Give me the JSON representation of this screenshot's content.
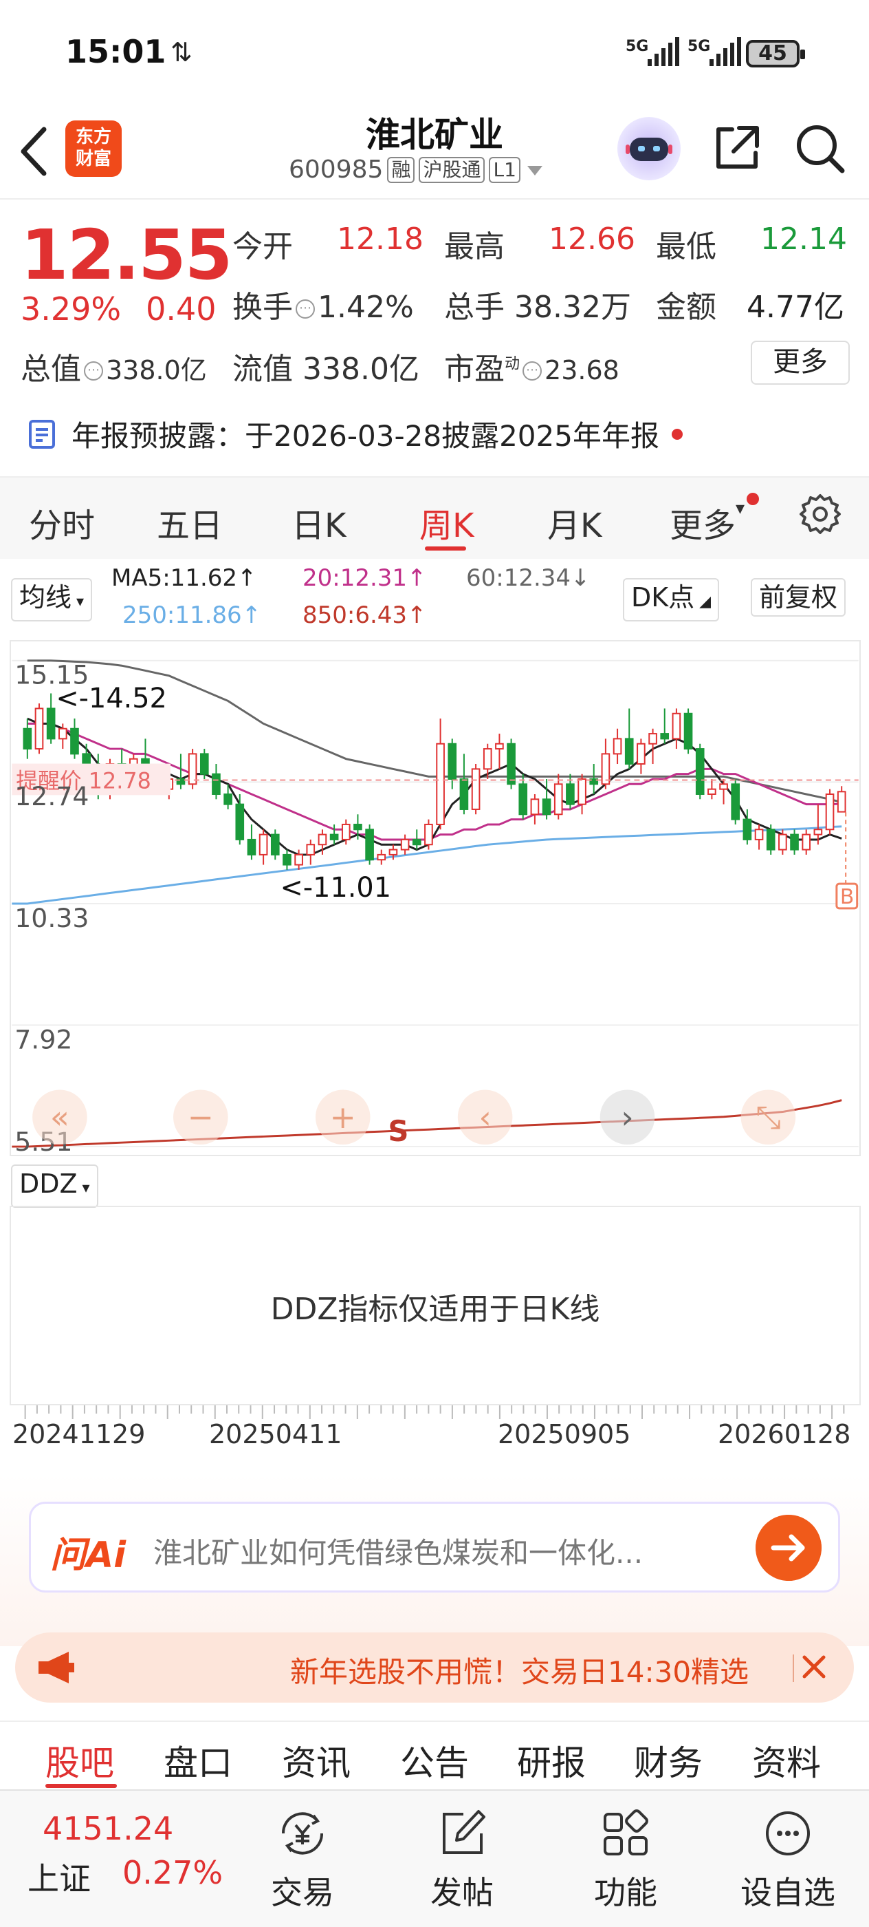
{
  "status": {
    "time": "15:01",
    "net_arrows": "⇅",
    "signal1": "5G",
    "signal2": "5G",
    "battery": "45"
  },
  "header": {
    "stock_name": "淮北矿业",
    "stock_code": "600985",
    "tag_rong": "融",
    "tag_hgt": "沪股通",
    "tag_l1": "L1",
    "logo_line1": "东方",
    "logo_line2": "财富"
  },
  "quote": {
    "price": "12.55",
    "change_pct": "3.29%",
    "change": "0.40",
    "open_label": "今开",
    "open": "12.18",
    "high_label": "最高",
    "high": "12.66",
    "low_label": "最低",
    "low": "12.14",
    "turnover_label": "换手",
    "turnover": "1.42%",
    "volume_label": "总手",
    "volume": "38.32万",
    "amount_label": "金额",
    "amount": "4.77亿",
    "mktcap_label": "总值",
    "mktcap": "338.0亿",
    "float_label": "流值",
    "float_cap": "338.0亿",
    "pe_label": "市盈",
    "pe_sup": "动",
    "pe": "23.68",
    "more": "更多"
  },
  "notice": "年报预披露：于2026-03-28披露2025年年报",
  "period_tabs": [
    "分时",
    "五日",
    "日K",
    "周K",
    "月K",
    "更多"
  ],
  "active_period": "周K",
  "ma_legend": {
    "selector": "均线",
    "ma5": "MA5:11.62↑",
    "ma20": "20:12.31↑",
    "ma60": "60:12.34↓",
    "ma250": "250:11.86↑",
    "ma850": "850:6.43↑",
    "dk_select": "DK点",
    "fq_select": "前复权",
    "color_ma5": "#222222",
    "color_ma20": "#c0308a",
    "color_ma60": "#666666",
    "color_ma250": "#6aaee6",
    "color_ma850": "#c0392b"
  },
  "chart_data": {
    "type": "candlestick",
    "y_ticks": [
      "15.15",
      "12.74",
      "10.33",
      "7.92",
      "5.51"
    ],
    "ylim": [
      5.51,
      15.15
    ],
    "annotation_high": "<-14.52",
    "annotation_low": "<-11.01",
    "alert_label": "提醒价 12.78",
    "alert_price": 12.78,
    "marker_b": "B",
    "marker_s": "S",
    "x_labels": [
      "20241129",
      "20250411",
      "20250905",
      "20260128"
    ],
    "candles": [
      [
        13.8,
        14.0,
        13.2,
        13.4
      ],
      [
        13.4,
        14.3,
        13.3,
        14.2
      ],
      [
        14.2,
        14.5,
        13.5,
        13.6
      ],
      [
        13.6,
        13.9,
        13.4,
        13.8
      ],
      [
        13.8,
        14.0,
        13.2,
        13.3
      ],
      [
        13.3,
        13.5,
        12.6,
        12.7
      ],
      [
        12.7,
        13.3,
        12.4,
        12.5
      ],
      [
        12.5,
        13.2,
        12.4,
        13.1
      ],
      [
        13.1,
        13.4,
        12.7,
        12.8
      ],
      [
        12.8,
        13.3,
        12.5,
        13.2
      ],
      [
        13.2,
        13.6,
        12.8,
        12.9
      ],
      [
        12.9,
        13.1,
        12.5,
        12.6
      ],
      [
        12.6,
        12.9,
        12.4,
        12.8
      ],
      [
        12.8,
        13.3,
        12.6,
        12.7
      ],
      [
        12.7,
        13.4,
        12.6,
        13.3
      ],
      [
        13.3,
        13.4,
        12.8,
        12.9
      ],
      [
        12.9,
        13.1,
        12.4,
        12.5
      ],
      [
        12.5,
        12.7,
        12.2,
        12.3
      ],
      [
        12.3,
        12.5,
        11.5,
        11.6
      ],
      [
        11.6,
        11.9,
        11.2,
        11.3
      ],
      [
        11.3,
        11.8,
        11.1,
        11.7
      ],
      [
        11.7,
        11.8,
        11.2,
        11.3
      ],
      [
        11.3,
        11.4,
        11.0,
        11.1
      ],
      [
        11.1,
        11.4,
        11.0,
        11.3
      ],
      [
        11.3,
        11.6,
        11.1,
        11.5
      ],
      [
        11.5,
        11.8,
        11.3,
        11.7
      ],
      [
        11.7,
        11.9,
        11.5,
        11.6
      ],
      [
        11.6,
        12.0,
        11.5,
        11.9
      ],
      [
        11.9,
        12.1,
        11.6,
        11.8
      ],
      [
        11.8,
        11.9,
        11.1,
        11.2
      ],
      [
        11.2,
        11.4,
        11.1,
        11.3
      ],
      [
        11.3,
        11.5,
        11.2,
        11.4
      ],
      [
        11.4,
        11.7,
        11.3,
        11.6
      ],
      [
        11.6,
        11.8,
        11.4,
        11.5
      ],
      [
        11.5,
        12.0,
        11.4,
        11.9
      ],
      [
        11.9,
        14.0,
        11.8,
        13.5
      ],
      [
        13.5,
        13.6,
        12.6,
        12.8
      ],
      [
        12.8,
        13.3,
        12.1,
        12.2
      ],
      [
        12.2,
        13.1,
        12.1,
        13.0
      ],
      [
        13.0,
        13.5,
        12.8,
        13.4
      ],
      [
        13.4,
        13.7,
        13.0,
        13.5
      ],
      [
        13.5,
        13.6,
        12.6,
        12.7
      ],
      [
        12.7,
        12.9,
        12.0,
        12.1
      ],
      [
        12.1,
        12.5,
        11.9,
        12.4
      ],
      [
        12.4,
        12.8,
        12.0,
        12.1
      ],
      [
        12.1,
        12.9,
        12.0,
        12.7
      ],
      [
        12.7,
        12.9,
        12.2,
        12.3
      ],
      [
        12.3,
        12.9,
        12.1,
        12.8
      ],
      [
        12.8,
        13.1,
        12.5,
        12.7
      ],
      [
        12.7,
        13.6,
        12.6,
        13.3
      ],
      [
        13.3,
        13.8,
        13.1,
        13.6
      ],
      [
        13.6,
        14.2,
        13.0,
        13.1
      ],
      [
        13.1,
        13.6,
        12.9,
        13.5
      ],
      [
        13.5,
        13.8,
        13.1,
        13.7
      ],
      [
        13.7,
        14.2,
        13.5,
        13.6
      ],
      [
        13.6,
        14.2,
        13.4,
        14.1
      ],
      [
        14.1,
        14.2,
        13.3,
        13.4
      ],
      [
        13.4,
        13.5,
        12.4,
        12.5
      ],
      [
        12.5,
        12.8,
        12.4,
        12.6
      ],
      [
        12.6,
        12.8,
        12.3,
        12.7
      ],
      [
        12.7,
        12.8,
        11.9,
        12.0
      ],
      [
        12.0,
        12.2,
        11.5,
        11.6
      ],
      [
        11.6,
        11.9,
        11.4,
        11.8
      ],
      [
        11.8,
        11.9,
        11.3,
        11.4
      ],
      [
        11.4,
        11.8,
        11.3,
        11.7
      ],
      [
        11.7,
        11.8,
        11.3,
        11.4
      ],
      [
        11.4,
        11.8,
        11.3,
        11.7
      ],
      [
        11.7,
        12.3,
        11.5,
        11.8
      ],
      [
        11.8,
        12.6,
        11.7,
        12.5
      ],
      [
        12.15,
        12.66,
        12.14,
        12.55
      ]
    ],
    "ma5": [
      14.0,
      13.9,
      13.9,
      13.8,
      13.6,
      13.4,
      13.1,
      13.0,
      12.9,
      12.8,
      12.9,
      12.9,
      12.9,
      12.8,
      12.9,
      12.9,
      12.8,
      12.7,
      12.3,
      12.0,
      11.8,
      11.6,
      11.4,
      11.3,
      11.3,
      11.4,
      11.5,
      11.6,
      11.7,
      11.6,
      11.5,
      11.5,
      11.5,
      11.4,
      11.5,
      11.9,
      12.3,
      12.5,
      12.8,
      12.9,
      13.0,
      13.1,
      12.9,
      12.8,
      12.6,
      12.4,
      12.3,
      12.4,
      12.5,
      12.7,
      12.9,
      13.0,
      13.2,
      13.4,
      13.5,
      13.6,
      13.5,
      13.3,
      13.0,
      12.7,
      12.4,
      12.0,
      11.9,
      11.8,
      11.7,
      11.6,
      11.6,
      11.6,
      11.7,
      11.62
    ],
    "ma20": [
      13.9,
      13.9,
      13.9,
      13.8,
      13.7,
      13.6,
      13.5,
      13.4,
      13.4,
      13.3,
      13.3,
      13.2,
      13.1,
      13.0,
      12.9,
      12.9,
      12.8,
      12.7,
      12.6,
      12.5,
      12.4,
      12.3,
      12.2,
      12.1,
      12.0,
      11.9,
      11.8,
      11.8,
      11.7,
      11.7,
      11.6,
      11.6,
      11.6,
      11.6,
      11.6,
      11.7,
      11.7,
      11.8,
      11.8,
      11.9,
      11.9,
      12.0,
      12.0,
      12.1,
      12.1,
      12.2,
      12.2,
      12.3,
      12.4,
      12.5,
      12.6,
      12.7,
      12.7,
      12.8,
      12.8,
      12.9,
      12.9,
      13.0,
      13.0,
      12.9,
      12.9,
      12.8,
      12.7,
      12.6,
      12.5,
      12.4,
      12.3,
      12.3,
      12.3,
      12.31
    ],
    "ma60": [
      15.15,
      15.15,
      15.15,
      15.14,
      15.13,
      15.12,
      15.1,
      15.08,
      15.05,
      15.0,
      14.95,
      14.9,
      14.85,
      14.75,
      14.65,
      14.55,
      14.45,
      14.35,
      14.2,
      14.05,
      13.9,
      13.8,
      13.7,
      13.6,
      13.5,
      13.4,
      13.3,
      13.2,
      13.15,
      13.1,
      13.05,
      13.0,
      12.95,
      12.9,
      12.85,
      12.85,
      12.85,
      12.85,
      12.85,
      12.85,
      12.85,
      12.85,
      12.85,
      12.85,
      12.85,
      12.85,
      12.85,
      12.85,
      12.85,
      12.85,
      12.85,
      12.85,
      12.85,
      12.85,
      12.85,
      12.85,
      12.85,
      12.85,
      12.85,
      12.85,
      12.8,
      12.75,
      12.7,
      12.65,
      12.6,
      12.55,
      12.5,
      12.45,
      12.4,
      12.34
    ],
    "ma250": [
      10.33,
      10.36,
      10.39,
      10.42,
      10.45,
      10.48,
      10.51,
      10.54,
      10.57,
      10.6,
      10.63,
      10.66,
      10.69,
      10.72,
      10.75,
      10.78,
      10.81,
      10.84,
      10.87,
      10.9,
      10.93,
      10.96,
      10.99,
      11.02,
      11.05,
      11.08,
      11.11,
      11.14,
      11.17,
      11.2,
      11.23,
      11.26,
      11.29,
      11.32,
      11.35,
      11.38,
      11.41,
      11.44,
      11.47,
      11.5,
      11.52,
      11.54,
      11.56,
      11.58,
      11.6,
      11.61,
      11.62,
      11.63,
      11.64,
      11.65,
      11.66,
      11.67,
      11.68,
      11.69,
      11.7,
      11.71,
      11.72,
      11.73,
      11.74,
      11.75,
      11.76,
      11.77,
      11.78,
      11.79,
      11.8,
      11.81,
      11.82,
      11.83,
      11.85,
      11.86
    ],
    "ma850": [
      5.51,
      5.52,
      5.53,
      5.54,
      5.55,
      5.56,
      5.57,
      5.58,
      5.59,
      5.6,
      5.61,
      5.62,
      5.63,
      5.64,
      5.65,
      5.66,
      5.67,
      5.68,
      5.69,
      5.7,
      5.71,
      5.72,
      5.73,
      5.74,
      5.75,
      5.76,
      5.77,
      5.78,
      5.79,
      5.8,
      5.81,
      5.82,
      5.83,
      5.84,
      5.85,
      5.86,
      5.87,
      5.88,
      5.89,
      5.9,
      5.91,
      5.92,
      5.93,
      5.94,
      5.95,
      5.96,
      5.97,
      5.98,
      5.99,
      6.0,
      6.01,
      6.02,
      6.03,
      6.04,
      6.05,
      6.06,
      6.07,
      6.08,
      6.09,
      6.1,
      6.12,
      6.14,
      6.16,
      6.18,
      6.2,
      6.24,
      6.28,
      6.32,
      6.37,
      6.43
    ]
  },
  "ddz": {
    "selector": "DDZ",
    "message": "DDZ指标仅适用于日K线"
  },
  "ai": {
    "logo": "问Ai",
    "prompt": "淮北矿业如何凭借绿色煤炭和一体化..."
  },
  "promo": {
    "text": "新年选股不用慌！交易日14:30精选"
  },
  "bottom_tabs": [
    "股吧",
    "盘口",
    "资讯",
    "公告",
    "研报",
    "财务",
    "资料"
  ],
  "bottom_nav": {
    "index_value": "4151.24",
    "index_name": "上证",
    "index_pct": "0.27%",
    "trade": "交易",
    "post": "发帖",
    "func": "功能",
    "watch": "设自选"
  }
}
